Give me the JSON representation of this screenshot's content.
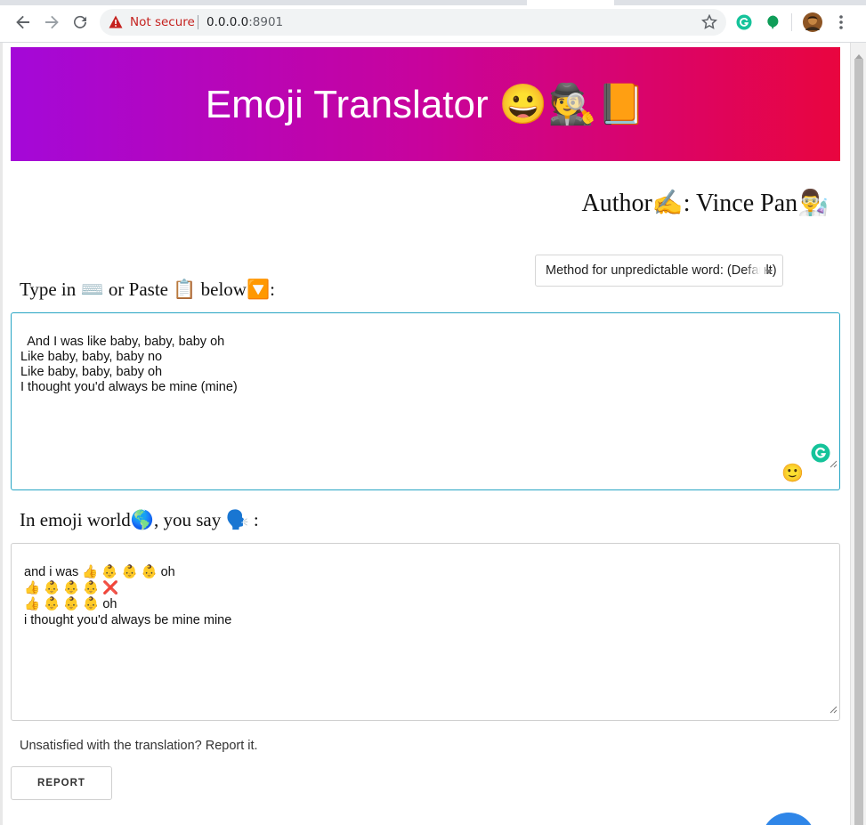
{
  "browser": {
    "security_label": "Not secure",
    "url_host": "0.0.0.0",
    "url_port": ":8901"
  },
  "app": {
    "title": "Emoji Translator 😀🕵️📙",
    "author": "Author✍️: Vince Pan👨‍🔬",
    "method_select": {
      "selected": "Method for unpredictable word: (Default)"
    },
    "input_label": "Type in ⌨️ or Paste 📋 below🔽:",
    "input_text": "And I was like baby, baby, baby oh\nLike baby, baby, baby no\nLike baby, baby, baby oh\nI thought you'd always be mine (mine)",
    "output_label": "In emoji world🌎, you say 🗣️ :",
    "output_lines": [
      "and i was 👍 👶 👶 👶 oh",
      "👍 👶 👶 👶 ❌",
      "👍 👶 👶 👶 oh",
      "i thought you'd always be mine mine"
    ],
    "report_prompt": "Unsatisfied with the translation? Report it.",
    "report_button": "REPORT"
  },
  "colors": {
    "banner_start": "#a408d8",
    "banner_end": "#e9053f",
    "input_border": "#27a5c4",
    "security_red": "#c5221f",
    "fab_blue": "#2f86e8"
  },
  "icons": [
    "back-arrow-icon",
    "forward-arrow-icon",
    "reload-icon",
    "warning-icon",
    "star-icon",
    "grammarly-icon",
    "extension-icon",
    "avatar",
    "menu-dots-icon",
    "smiley-icon"
  ]
}
